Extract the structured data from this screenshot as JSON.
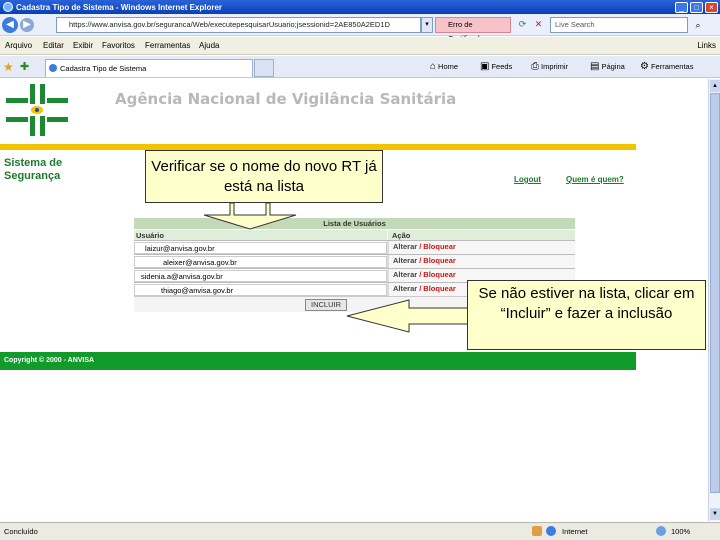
{
  "window": {
    "title": "Cadastra Tipo de Sistema - Windows Internet Explorer"
  },
  "address": {
    "url": "https://www.anvisa.gov.br/seguranca/Web/executepesquisarUsuario;jsessionid=2AE850A2ED1D",
    "cert_error": "Erro de Certificado",
    "search_placeholder": "Live Search"
  },
  "menu": {
    "items": [
      "Arquivo",
      "Editar",
      "Exibir",
      "Favoritos",
      "Ferramentas",
      "Ajuda"
    ],
    "links": "Links"
  },
  "toolbar": {
    "tab_title": "Cadastra Tipo de Sistema",
    "home": "Home",
    "feeds": "Feeds",
    "print": "Imprimir",
    "page": "Página",
    "tools": "Ferramentas"
  },
  "page": {
    "site_title": "Agência Nacional de Vigilância Sanitária",
    "system_title": "Sistema de Segurança",
    "logout_link": "Logout",
    "who_link": "Quem é quem?",
    "table": {
      "caption": "Lista de Usuários",
      "col_user": "Usuário",
      "col_action": "Ação",
      "rows": [
        {
          "user": "laizur@anvisa.gov.br",
          "edit": "Alterar",
          "block": "Bloquear"
        },
        {
          "user": "aleixer@anvisa.gov.br",
          "edit": "Alterar",
          "block": "Bloquear"
        },
        {
          "user": "sidenia.a@anvisa.gov.br",
          "edit": "Alterar",
          "block": "Bloquear"
        },
        {
          "user": "thiago@anvisa.gov.br",
          "edit": "Alterar",
          "block": "Bloquear"
        }
      ],
      "button": "INCLUIR"
    },
    "footer": "Copyright © 2000 - ANVISA"
  },
  "callouts": {
    "top": "Verificar se o nome do novo RT já está na lista",
    "right": "Se não estiver na lista, clicar em “Incluir” e fazer a inclusão"
  },
  "status": {
    "text": "Concluído",
    "zone": "Internet",
    "zoom": "100%"
  },
  "colors": {
    "anvisa_green": "#129a2b",
    "anvisa_yellow": "#f2c400",
    "callout_bg": "#ffffcc",
    "block_red": "#c81818"
  }
}
